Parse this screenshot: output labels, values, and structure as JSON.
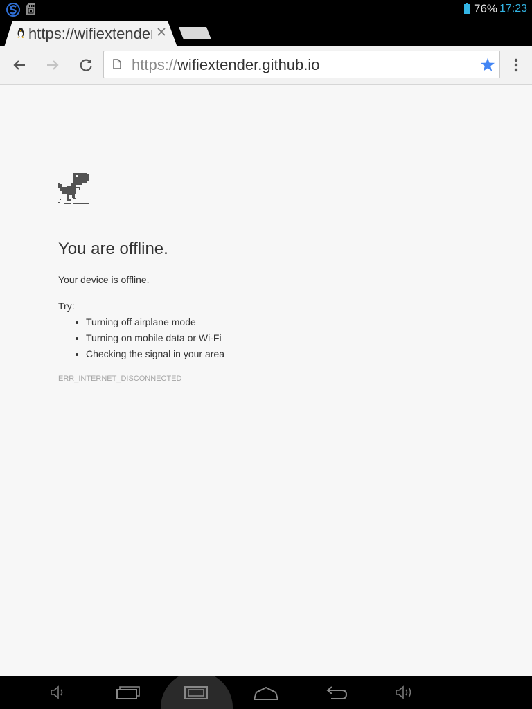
{
  "status_bar": {
    "battery_percent": "76%",
    "clock": "17:23",
    "icons": [
      "s-notification-icon",
      "sd-card-icon",
      "battery-icon"
    ],
    "clock_color": "#33b5e5"
  },
  "tab": {
    "title": "https://wifiextender.github.io",
    "favicon": "penguin-favicon-icon",
    "close_icon": "close-icon"
  },
  "new_tab": {
    "icon": "new-tab-icon"
  },
  "toolbar": {
    "back_icon": "back-arrow-icon",
    "forward_icon": "forward-arrow-icon",
    "reload_icon": "reload-icon",
    "menu_icon": "overflow-menu-icon"
  },
  "omnibox": {
    "scheme": "https://",
    "host": "wifiextender.github.io",
    "page_info_icon": "page-icon",
    "bookmark_icon": "star-icon",
    "bookmark_color": "#4285f4"
  },
  "error_page": {
    "icon": "dino-icon",
    "heading": "You are offline.",
    "description": "Your device is offline.",
    "try_label": "Try:",
    "suggestions": [
      "Turning off airplane mode",
      "Turning on mobile data or Wi-Fi",
      "Checking the signal in your area"
    ],
    "error_code": "ERR_INTERNET_DISCONNECTED"
  },
  "nav_bar": {
    "buttons": [
      "volume-down-icon",
      "recent-apps-icon",
      "screenshot-icon",
      "home-icon",
      "back-icon",
      "volume-up-icon"
    ]
  }
}
